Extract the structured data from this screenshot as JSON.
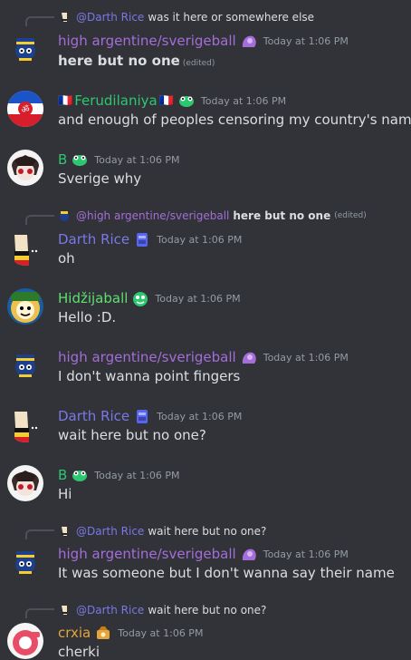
{
  "colors": {
    "bg": "#313338",
    "high_argentine": "#a46dd8",
    "darth_rice": "#7a78e6",
    "ferudilaniya": "#2dc770",
    "b": "#2dc770",
    "hidzijaball": "#5de06c",
    "crxia": "#e5a53b",
    "text": "#dbdee1",
    "muted": "#949ba4"
  },
  "messages": [
    {
      "reply": {
        "name": "@Darth Rice",
        "text": "was it here or somewhere else",
        "edited": ""
      },
      "author": "high argentine/sverigeball",
      "timestamp": "Today at 1:06 PM",
      "content": "here but no one",
      "edited": "(edited)"
    },
    {
      "author": "Ferudilaniya",
      "flag_left": "🇫🇷",
      "flag_right": "🇫🇷",
      "timestamp": "Today at 1:06 PM",
      "content": "and enough of peoples censoring my country's name"
    },
    {
      "author": "B",
      "timestamp": "Today at 1:06 PM",
      "content": "Sverige why"
    },
    {
      "reply": {
        "name": "@high argentine/sverigeball",
        "text": "here but no one",
        "edited": "(edited)"
      },
      "author": "Darth Rice",
      "timestamp": "Today at 1:06 PM",
      "content": "oh"
    },
    {
      "author": "Hidžijaball",
      "timestamp": "Today at 1:06 PM",
      "content": "Hello :D."
    },
    {
      "author": "high argentine/sverigeball",
      "timestamp": "Today at 1:06 PM",
      "content": "I don't wanna point fingers"
    },
    {
      "author": "Darth Rice",
      "timestamp": "Today at 1:06 PM",
      "content": "wait here but no one?"
    },
    {
      "author": "B",
      "timestamp": "Today at 1:06 PM",
      "content": "Hi"
    },
    {
      "reply": {
        "name": "@Darth Rice",
        "text": "wait here but no one?",
        "edited": ""
      },
      "author": "high argentine/sverigeball",
      "timestamp": "Today at 1:06 PM",
      "content": "It was someone but I don't wanna say their name"
    },
    {
      "reply": {
        "name": "@Darth Rice",
        "text": "wait here but no one?",
        "edited": ""
      },
      "author": "crxia",
      "timestamp": "Today at 1:06 PM",
      "content": "cherki"
    }
  ]
}
